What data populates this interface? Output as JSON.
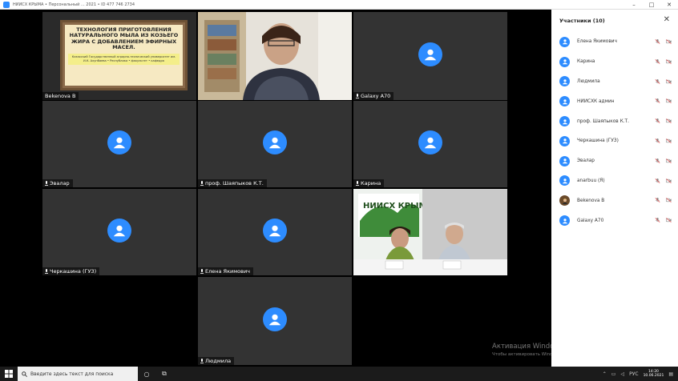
{
  "window": {
    "title": "НИИСХ КРЫМА • Персональный ... 2021 • ID 477 746 2734",
    "controls": [
      "–",
      "□",
      "✕"
    ]
  },
  "tiles": [
    {
      "name": "Bekenova B",
      "type": "slide"
    },
    {
      "name": "",
      "type": "camera-woman"
    },
    {
      "name": "Galaxy A70",
      "type": "avatar"
    },
    {
      "name": "Эвалар",
      "type": "avatar"
    },
    {
      "name": "проф. Шаяпыков К.Т.",
      "type": "avatar"
    },
    {
      "name": "Карина",
      "type": "avatar"
    },
    {
      "name": "Черкашина (ГУЗ)",
      "type": "avatar"
    },
    {
      "name": "Елена Якимович",
      "type": "avatar"
    },
    {
      "name": "",
      "type": "camera-panel"
    },
    {
      "name": "Людмила",
      "type": "avatar"
    }
  ],
  "slide": {
    "title": "ТЕХНОЛОГИЯ ПРИГОТОВЛЕНИЯ НАТУРАЛЬНОГО МЫЛА ИЗ КОЗЬЕГО ЖИРА С ДОБАВЛЕНИЕМ ЭФИРНЫХ МАСЕЛ.",
    "body": "Казахский Государственный аграрно-технический университет им. И.К. Ахунбаева • Республика • факультет • кафедра"
  },
  "camera_sign": "НИИСХ КРЫМА",
  "panel": {
    "title": "Участники (10)",
    "participants": [
      {
        "name": "Елена Якимович",
        "avatar": "person"
      },
      {
        "name": "Карина",
        "avatar": "person"
      },
      {
        "name": "Людмила",
        "avatar": "person"
      },
      {
        "name": "НИИСХК админ",
        "avatar": "person"
      },
      {
        "name": "проф. Шаяпыков К.Т.",
        "avatar": "person"
      },
      {
        "name": "Черкашина (ГУЗ)",
        "avatar": "person"
      },
      {
        "name": "Эвалар",
        "avatar": "person"
      },
      {
        "name": "anarbuu (Я)",
        "avatar": "person"
      },
      {
        "name": "Bekenova B",
        "avatar": "photo"
      },
      {
        "name": "Galaxy A70",
        "avatar": "person"
      }
    ]
  },
  "watermark": {
    "line1": "Активация Windows",
    "line2": "Чтобы активировать Windows, перейдите в раздел \"Параметры\"."
  },
  "taskbar": {
    "search_placeholder": "Введите здесь текст для поиска",
    "language": "РУС",
    "time": "14:20",
    "date": "10.06.2021"
  },
  "colors": {
    "accent": "#2d8cff",
    "tile_bg": "#333333",
    "stage_bg": "#000000"
  }
}
